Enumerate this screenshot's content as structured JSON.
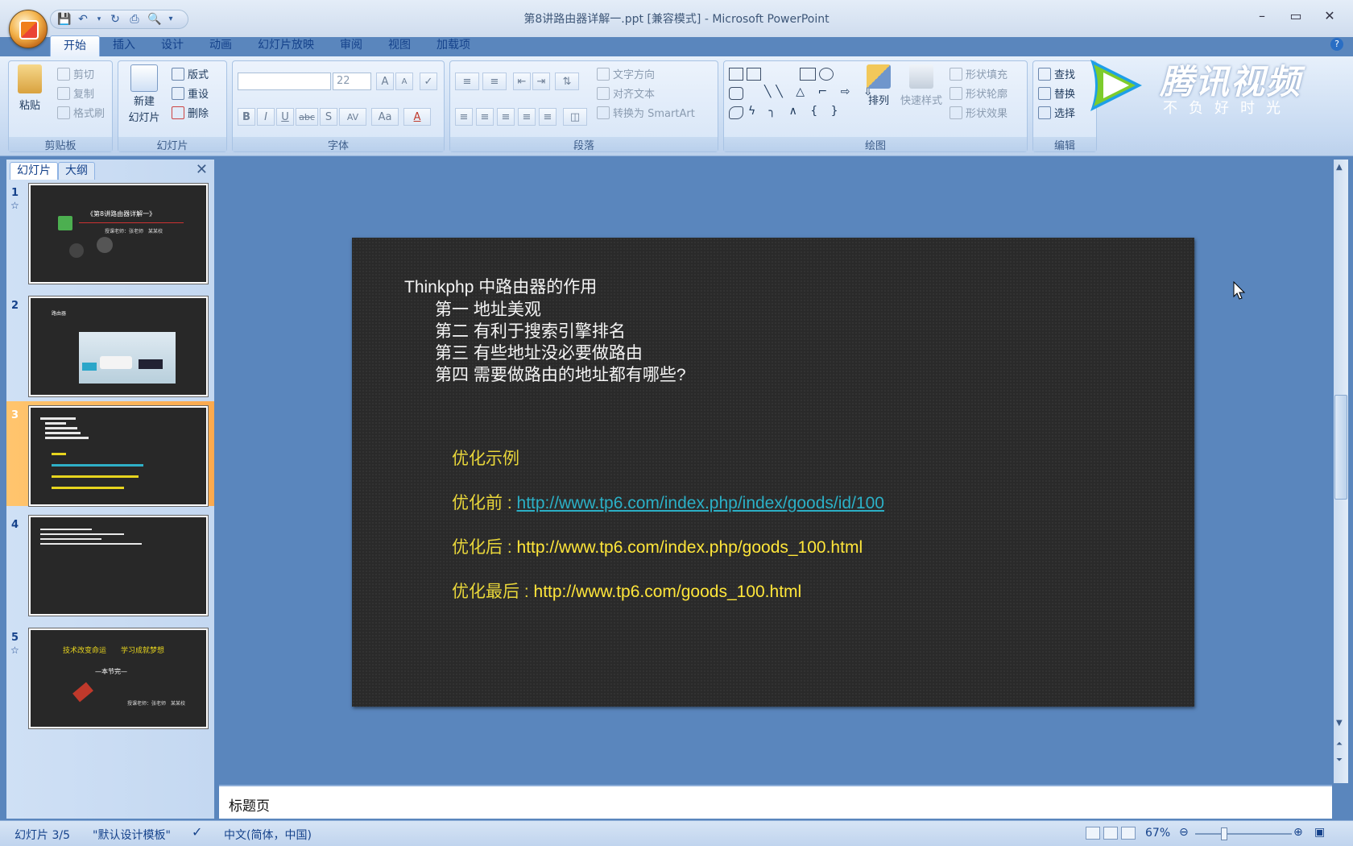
{
  "window": {
    "title": "第8讲路由器详解一.ppt [兼容模式] - Microsoft PowerPoint"
  },
  "ribbon": {
    "tabs": [
      {
        "label": "开始"
      },
      {
        "label": "插入"
      },
      {
        "label": "设计"
      },
      {
        "label": "动画"
      },
      {
        "label": "幻灯片放映"
      },
      {
        "label": "审阅"
      },
      {
        "label": "视图"
      },
      {
        "label": "加载项"
      }
    ],
    "clipboard": {
      "label": "剪贴板",
      "paste": "粘贴",
      "cut": "剪切",
      "copy": "复制",
      "format_painter": "格式刷"
    },
    "slides": {
      "label": "幻灯片",
      "new_slide_line1": "新建",
      "new_slide_line2": "幻灯片",
      "layout": "版式",
      "reset": "重设",
      "delete": "删除"
    },
    "font": {
      "label": "字体",
      "size": "22",
      "bold": "B",
      "italic": "I",
      "underline": "U",
      "strike": "abc",
      "shadow": "S",
      "spacing": "AV",
      "case": "Aa",
      "grow": "A",
      "shrink": "A"
    },
    "paragraph": {
      "label": "段落",
      "text_direction": "文字方向",
      "align_text": "对齐文本",
      "smartart": "转换为 SmartArt"
    },
    "drawing": {
      "label": "绘图",
      "arrange": "排列",
      "quick_styles": "快速样式",
      "shape_fill": "形状填充",
      "shape_outline": "形状轮廓",
      "shape_effects": "形状效果"
    },
    "editing": {
      "label": "编辑",
      "find": "查找",
      "replace": "替换",
      "select": "选择"
    }
  },
  "watermark": {
    "title": "腾讯视频",
    "subtitle": "不负好时光"
  },
  "left_pane": {
    "tabs": [
      {
        "label": "幻灯片"
      },
      {
        "label": "大纲"
      }
    ],
    "selected_index": 3,
    "thumbnails": [
      {
        "number": "1",
        "title": "《第8讲路由器详解一》",
        "sub": "授课老师：张老师　某某校"
      },
      {
        "number": "2",
        "title": "路由器"
      },
      {
        "number": "3"
      },
      {
        "number": "4"
      },
      {
        "number": "5",
        "title": "技术改变命运　　学习成就梦想",
        "sub": "—本节完—",
        "footer": "授课老师：张老师　某某校"
      }
    ]
  },
  "slide": {
    "heading": "Thinkphp 中路由器的作用",
    "points": [
      "第一 地址美观",
      "第二 有利于搜索引擎排名",
      "第三  有些地址没必要做路由",
      "第四  需要做路由的地址都有哪些?"
    ],
    "example_title": "优化示例",
    "before_label": "优化前 : ",
    "before_url": "http://www.tp6.com/index.php/index/goods/id/100",
    "after_label": "优化后 : ",
    "after_url": "http://www.tp6.com/index.php/goods_100.html",
    "final_label": "优化最后 : ",
    "final_url": "http://www.tp6.com/goods_100.html"
  },
  "notes": {
    "text": "标题页"
  },
  "status": {
    "slide_info": "幻灯片 3/5",
    "theme": "\"默认设计模板\"",
    "language": "中文(简体，中国)",
    "zoom": "67%"
  },
  "colors": {
    "slide_bg": "#2a2a2a",
    "slide_yellow": "#e8d63a",
    "slide_link": "#2bb0c6",
    "selected_thumb": "#fba94e"
  }
}
